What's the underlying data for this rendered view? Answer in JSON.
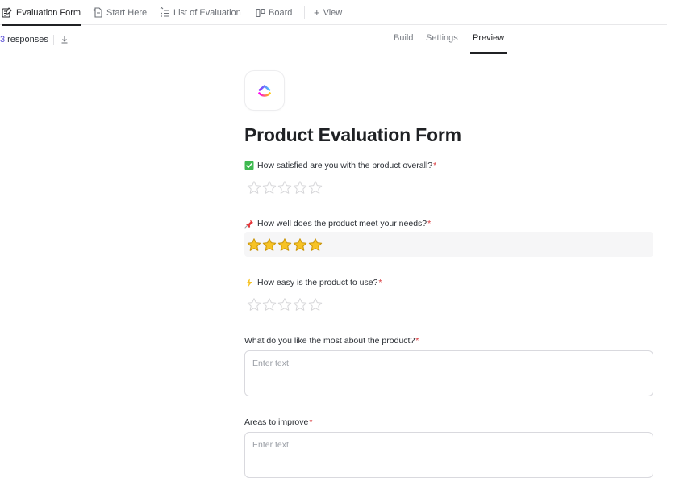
{
  "view_tabs": [
    {
      "label": "Evaluation Form",
      "icon": "form-icon",
      "active": true
    },
    {
      "label": "Start Here",
      "icon": "doc-icon",
      "active": false
    },
    {
      "label": "List of Evaluation",
      "icon": "list-icon",
      "active": false
    },
    {
      "label": "Board",
      "icon": "board-icon",
      "active": false
    }
  ],
  "add_view": {
    "icon": "+",
    "label": "View"
  },
  "responses": {
    "count": "3",
    "label": "responses",
    "icon": "download-icon"
  },
  "mode_tabs": [
    {
      "label": "Build",
      "active": false
    },
    {
      "label": "Settings",
      "active": false
    },
    {
      "label": "Preview",
      "active": true
    }
  ],
  "form": {
    "logo_icon": "clickup-logo-icon",
    "title": "Product Evaluation Form",
    "required_mark": "*",
    "questions": [
      {
        "label": "How satisfied are you with the product overall?",
        "emoji": "check-emoji-icon",
        "type": "rating",
        "max": 5,
        "rating": 0
      },
      {
        "label": "How well does the product meet your needs?",
        "emoji": "pin-emoji-icon",
        "type": "rating",
        "max": 5,
        "rating": 5
      },
      {
        "label": "How easy is the product to use?",
        "emoji": "lightning-emoji-icon",
        "type": "rating",
        "max": 5,
        "rating": 0
      },
      {
        "label": "What do you like the most about the product?",
        "type": "text",
        "placeholder": "Enter text"
      },
      {
        "label": "Areas to improve",
        "type": "text",
        "placeholder": "Enter text"
      }
    ]
  },
  "colors": {
    "accent": "#5a4fd8",
    "required": "#d8363a",
    "star_filled": "#f7c325",
    "star_empty": "#d6d6d9"
  }
}
